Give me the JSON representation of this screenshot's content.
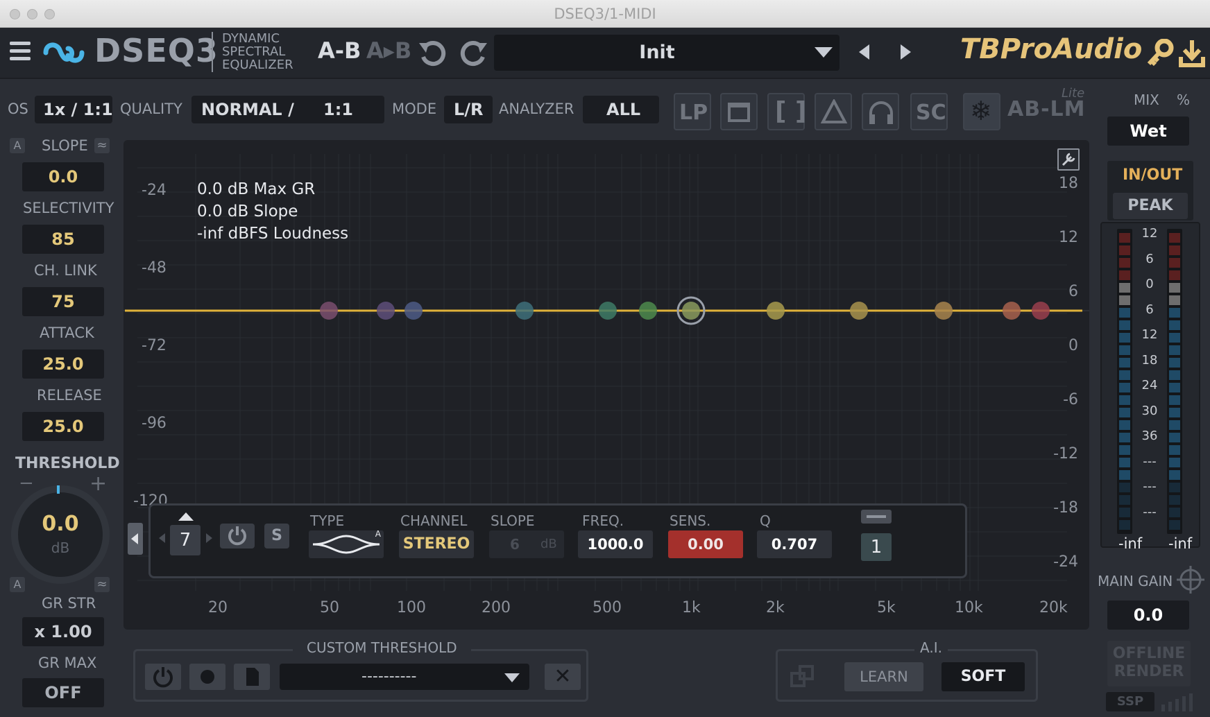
{
  "window": {
    "title": "DSEQ3/1-MIDI"
  },
  "header": {
    "logo": "DSEQ3",
    "subtitle_lines": [
      "DYNAMIC",
      "SPECTRAL",
      "EQUALIZER"
    ],
    "ab1": "A-B",
    "ab2": "A▸B",
    "preset": "Init",
    "brand": "TBProAudio"
  },
  "toolbar": {
    "os_label": "OS",
    "os_value": "1x / 1:1",
    "quality_label": "QUALITY",
    "quality_value": "NORMAL /",
    "quality_ratio": "1:1",
    "mode_label": "MODE",
    "mode_value": "L/R",
    "analyzer_label": "ANALYZER",
    "analyzer_value": "ALL",
    "lp": "LP",
    "sc": "SC",
    "ablm": "AB-LM",
    "ablm_sup": "Lite"
  },
  "left": {
    "a1": "A",
    "slope_label": "SLOPE",
    "slope_value": "0.0",
    "selectivity_label": "SELECTIVITY",
    "selectivity_value": "85",
    "chlink_label": "CH. LINK",
    "chlink_value": "75",
    "attack_label": "ATTACK",
    "attack_value": "25.0",
    "release_label": "RELEASE",
    "release_value": "25.0",
    "threshold_label": "THRESHOLD",
    "minus": "−",
    "plus": "+",
    "threshold_value": "0.0",
    "threshold_unit": "dB",
    "a2": "A",
    "grstr_label": "GR STR",
    "grstr_value": "x 1.00",
    "grmax_label": "GR MAX",
    "grmax_value": "OFF"
  },
  "graph": {
    "info": [
      "0.0 dB Max GR",
      "0.0 dB Slope",
      "-inf dBFS Loudness"
    ],
    "left_scale": [
      "-24",
      "-48",
      "-72",
      "-96",
      "-120"
    ],
    "right_scale": [
      "18",
      "12",
      "6",
      "0",
      "-6",
      "-12",
      "-18",
      "-24"
    ],
    "freq_ticks": [
      "20",
      "50",
      "100",
      "200",
      "500",
      "1k",
      "2k",
      "5k",
      "10k",
      "20k"
    ],
    "band_colors": [
      "#7a4e6e",
      "#5e4e7a",
      "#4e5a86",
      "#3e6e7a",
      "#3e7a66",
      "#4e8a4e",
      "#8a9a5e",
      "#a89a4e",
      "#a8924e",
      "#a8844e",
      "#a8604e",
      "#9a3e4e"
    ]
  },
  "band_panel": {
    "band_number": "7",
    "solo": "S",
    "type_label": "TYPE",
    "type_tag": "A",
    "channel_label": "CHANNEL",
    "channel_value": "STEREO",
    "slope_label": "SLOPE",
    "slope_value": "6",
    "slope_unit": "dB",
    "freq_label": "FREQ.",
    "freq_value": "1000.0",
    "sens_label": "SENS.",
    "sens_value": "0.00",
    "q_label": "Q",
    "q_value": "0.707",
    "page": "1"
  },
  "custom_threshold": {
    "label": "CUSTOM THRESHOLD",
    "preset": "----------"
  },
  "ai": {
    "label": "A.I.",
    "learn": "LEARN",
    "soft": "SOFT"
  },
  "right": {
    "mix_label": "MIX",
    "mix_unit": "%",
    "mix_value": "Wet",
    "inout": "IN/OUT",
    "peak": "PEAK",
    "scale": [
      "12",
      "6",
      "0",
      "6",
      "12",
      "18",
      "24",
      "30",
      "36",
      "---",
      "---",
      "---"
    ],
    "left_inf": "-inf",
    "right_inf": "-inf",
    "main_gain_label": "MAIN GAIN",
    "main_gain_value": "0.0",
    "offline": "OFFLINE RENDER",
    "ssp": "SSP"
  }
}
